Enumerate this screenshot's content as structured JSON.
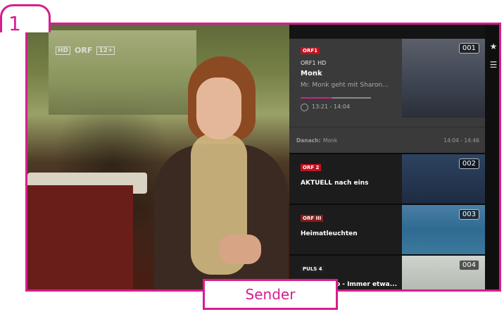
{
  "step": {
    "number": "1"
  },
  "colors": {
    "accent": "#d61e8e",
    "panel": "#141414",
    "active_card": "#3a3a3a"
  },
  "tv": {
    "logo": "ORF",
    "hd": "HD",
    "rating": "12+"
  },
  "active_channel": {
    "number": "001",
    "logo": "ORF1",
    "channel_name": "ORF1 HD",
    "title": "Monk",
    "description": "Mr. Monk geht mit Sharon...",
    "progress": 0.45,
    "time_range": "13:21 - 14:04",
    "next_label": "Danach:",
    "next_show": "Monk",
    "next_time": "14:04 - 14:46"
  },
  "channels": [
    {
      "number": "002",
      "logo": "ORF 2",
      "title": "AKTUELL nach eins",
      "logo_color": "#c2121f"
    },
    {
      "number": "003",
      "logo": "ORF III",
      "title": "Heimatleuchten",
      "logo_color": "#8a1a1a"
    },
    {
      "number": "004",
      "logo": "PULS 4",
      "title": "MediaShop - Immer etwa...",
      "logo_color": "#222222"
    }
  ],
  "sidebar": {
    "favorites_icon": "star-icon",
    "list_icon": "channel-list-icon"
  },
  "caption": "Sender"
}
